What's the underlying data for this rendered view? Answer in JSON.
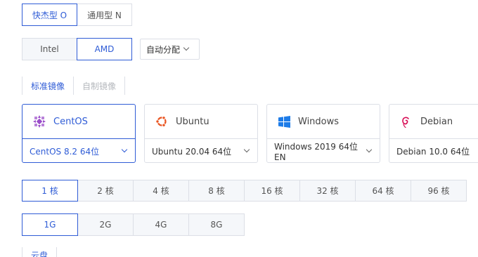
{
  "family": {
    "options": [
      "快杰型 O",
      "通用型 N"
    ],
    "selected": 0
  },
  "arch": {
    "options": [
      "Intel",
      "AMD"
    ],
    "selected": 1,
    "dropdown_label": "自动分配"
  },
  "image_tabs": [
    "标准镜像",
    "自制镜像"
  ],
  "os_cards": [
    {
      "name": "CentOS",
      "version": "CentOS 8.2 64位",
      "icon": "centos-icon"
    },
    {
      "name": "Ubuntu",
      "version": "Ubuntu 20.04 64位",
      "icon": "ubuntu-icon"
    },
    {
      "name": "Windows",
      "version": "Windows 2019 64位 EN",
      "icon": "windows-icon"
    },
    {
      "name": "Debian",
      "version": "Debian 10.0 64位",
      "icon": "debian-icon"
    }
  ],
  "cores": [
    "1 核",
    "2 核",
    "4 核",
    "8 核",
    "16 核",
    "32 核",
    "64 核",
    "96 核"
  ],
  "memory": [
    "1G",
    "2G",
    "4G",
    "8G"
  ],
  "bottom_tab": "云盘",
  "colors": {
    "accent": "#2f5cd6",
    "border": "#dcdfe6",
    "ubuntu": "#e95420",
    "windows": "#1e7ce8",
    "debian": "#d70a53",
    "centos": "#9b4dca"
  }
}
